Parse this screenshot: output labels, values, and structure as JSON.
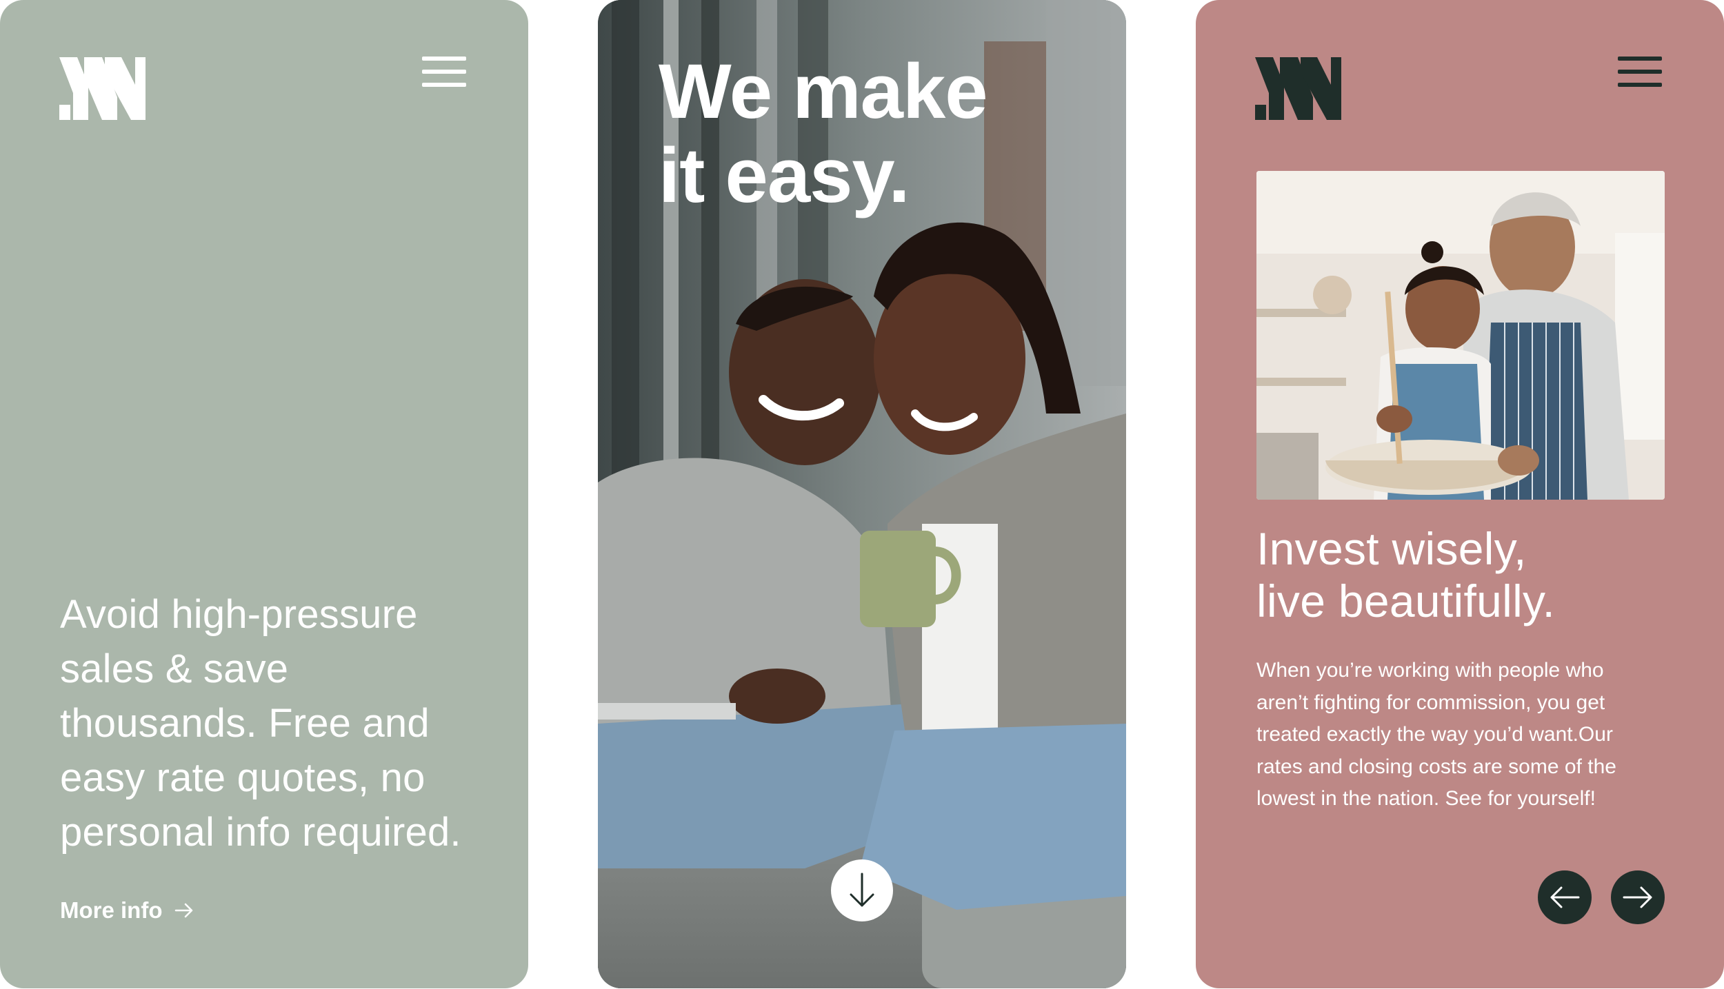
{
  "colors": {
    "left_bg": "#abb7ab",
    "right_bg": "#bd8886",
    "dark": "#1f2e2a",
    "text_light": "#ffffff"
  },
  "left_panel": {
    "logo_icon": "brand-logo-icon",
    "menu_icon": "hamburger-menu-icon",
    "body_lines": [
      "Avoid high-pressure",
      "sales & save",
      "thousands. Free and",
      "easy rate quotes, no",
      "personal info required."
    ],
    "more_link": "More info",
    "more_icon": "arrow-right-icon"
  },
  "mid_panel": {
    "headline_lines": [
      "We make",
      "it easy."
    ],
    "photo_icon": "couple-laughing-photo",
    "scroll_icon": "arrow-down-icon"
  },
  "right_panel": {
    "logo_icon": "brand-logo-icon",
    "menu_icon": "hamburger-menu-icon",
    "photo_icon": "grandmother-child-baking-photo",
    "headline_lines": [
      "Invest wisely,",
      "live beautifully."
    ],
    "body_lines": [
      "When you’re working with people who",
      "aren’t fighting for commission, you get",
      "treated exactly the way you’d want.Our",
      "rates and closing costs are some of the",
      "lowest in the nation. See for yourself!"
    ],
    "prev_icon": "arrow-left-icon",
    "next_icon": "arrow-right-icon"
  }
}
